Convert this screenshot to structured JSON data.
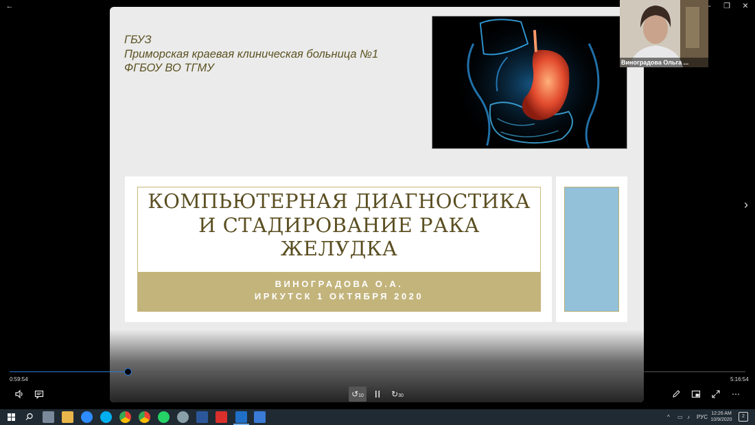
{
  "window": {
    "back_glyph": "←",
    "min_glyph": "—",
    "max_glyph": "❐",
    "close_glyph": "✕"
  },
  "slide": {
    "org_lines": [
      "ГБУЗ",
      "Приморская краевая клиническая больница №1",
      "ФГБОУ ВО ТГМУ"
    ],
    "title_lines": [
      "КОМПЬЮТЕРНАЯ ДИАГНОСТИКА",
      "И СТАДИРОВАНИЕ РАКА",
      "ЖЕЛУДКА"
    ],
    "subtitle_lines": [
      "ВИНОГРАДОВА О.А.",
      "ИРКУТСК 1 ОКТЯБРЯ 2020"
    ],
    "colors": {
      "title": "#5b4f22",
      "gold": "#c3b47c",
      "side_blue": "#92c1d9"
    }
  },
  "webcam": {
    "name": "Виноградова Ольга ..."
  },
  "player": {
    "current_time": "0:59:54",
    "total_time": "5:16:54",
    "progress_fraction": 0.1605,
    "skip_back_seconds": "10",
    "skip_forward_seconds": "30",
    "icons": {
      "volume": "volume-icon",
      "captions": "captions-icon",
      "pause": "pause-icon",
      "pen": "pen-icon",
      "mini": "mini-view-icon",
      "fullscreen": "fullscreen-icon",
      "more": "more-icon"
    }
  },
  "taskbar": {
    "lang": "РУС",
    "time": "12:26 AM",
    "date": "10/9/2020",
    "notifications": "2"
  }
}
